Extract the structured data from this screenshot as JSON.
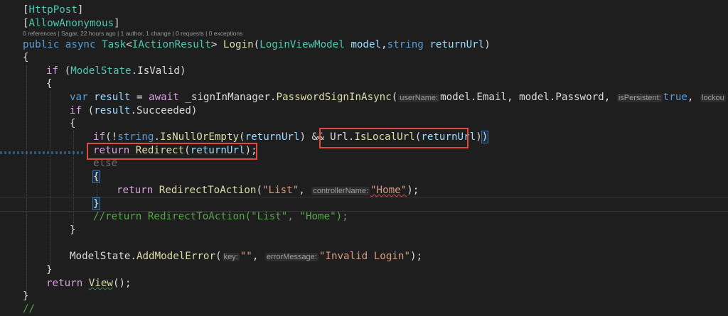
{
  "code_lens": "0 references | Sagar, 22 hours ago | 1 author, 1 change | 0 requests | 0 exceptions",
  "hints": {
    "userName": "userName:",
    "isPersistent": "isPersistent:",
    "lockout": "lockou",
    "controllerName": "controllerName:",
    "key": "key:",
    "errorMessage": "errorMessage:"
  },
  "code": {
    "l1_attr": "HttpPost",
    "l2_attr": "AllowAnonymous",
    "l3_public": "public",
    "l3_async": "async",
    "l3_task": "Task",
    "l3_iresult": "IActionResult",
    "l3_login": "Login",
    "l3_vm": "LoginViewModel",
    "l3_model": "model",
    "l3_string": "string",
    "l3_returnUrl": "returnUrl",
    "l5_if": "if",
    "l5_modelstate": "ModelState",
    "l5_isvalid": "IsValid",
    "l7_var": "var",
    "l7_result": "result",
    "l7_await": "await",
    "l7_signin": "_signInManager",
    "l7_method": "PasswordSignInAsync",
    "l7_model_email": "model.Email, model.Password,",
    "l7_true": "true",
    "l8_if": "if",
    "l8_result": "result",
    "l8_succeeded": "Succeeded",
    "l10_if": "if",
    "l10_string": "string",
    "l10_isnull": "IsNullOrEmpty",
    "l10_returnUrl": "returnUrl",
    "l10_url": "Url",
    "l10_islocal": "IsLocalUrl",
    "l10_returnUrl2": "returnUrl",
    "l11_return": "return",
    "l11_redirect": "Redirect",
    "l11_returnUrl": "returnUrl",
    "l12_else": "else",
    "l14_return": "return",
    "l14_rta": "RedirectToAction",
    "l14_list": "\"List\"",
    "l14_home": "\"Home\"",
    "l16_comment": "//return RedirectToAction(\"List\", \"Home\");",
    "l19_modelstate": "ModelState",
    "l19_add": "AddModelError",
    "l19_empty": "\"\"",
    "l19_invalid": "\"Invalid Login\"",
    "l21_return": "return",
    "l21_view": "View",
    "l23_comment": "//"
  }
}
